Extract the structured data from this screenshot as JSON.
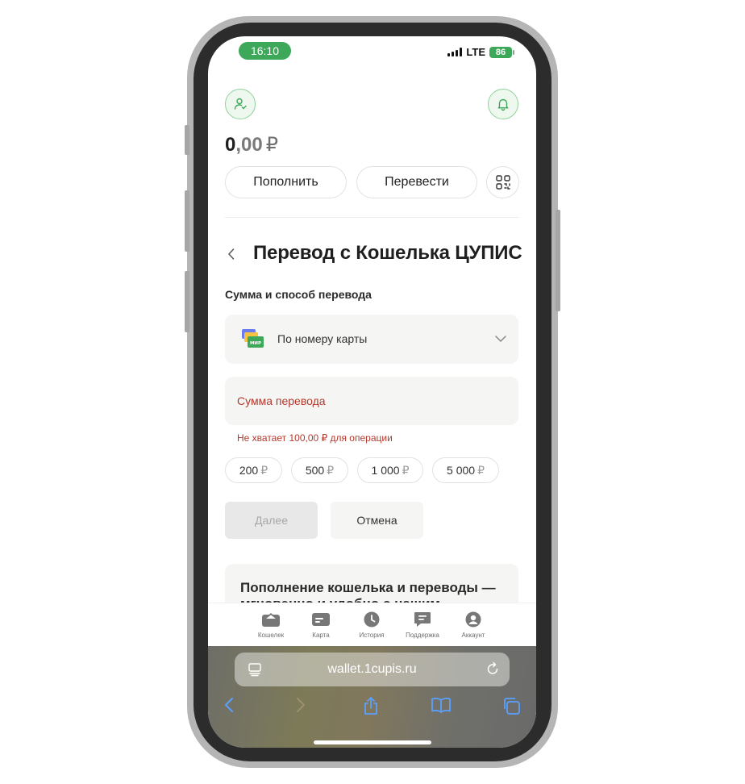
{
  "status_bar": {
    "time": "16:10",
    "network": "LTE",
    "battery": "86"
  },
  "header": {
    "balance_int": "0",
    "balance_dec": ",00",
    "currency": "₽",
    "topup_label": "Пополнить",
    "transfer_label": "Перевести"
  },
  "transfer": {
    "title": "Перевод с Кошелька ЦУПИС",
    "section_label": "Сумма и способ перевода",
    "method_label": "По номеру карты",
    "method_icon_text": "МИР",
    "amount_placeholder": "Сумма перевода",
    "error": "Не хватает 100,00 ₽ для операции",
    "chips": [
      {
        "amount": "200",
        "currency": "₽"
      },
      {
        "amount": "500",
        "currency": "₽"
      },
      {
        "amount": "1 000",
        "currency": "₽"
      },
      {
        "amount": "5 000",
        "currency": "₽"
      }
    ],
    "next_label": "Далее",
    "cancel_label": "Отмена",
    "promo_title": "Пополнение кошелька и переводы — мгновенно и удобно с нашим"
  },
  "tabs": [
    {
      "label": "Кошелек",
      "icon": "wallet-icon"
    },
    {
      "label": "Карта",
      "icon": "card-icon"
    },
    {
      "label": "История",
      "icon": "clock-icon"
    },
    {
      "label": "Поддержка",
      "icon": "chat-icon"
    },
    {
      "label": "Аккаунт",
      "icon": "user-icon"
    }
  ],
  "browser": {
    "url": "wallet.1cupis.ru"
  },
  "colors": {
    "accent": "#3da85a",
    "error": "#b23a2e",
    "surface": "#f5f5f3"
  }
}
